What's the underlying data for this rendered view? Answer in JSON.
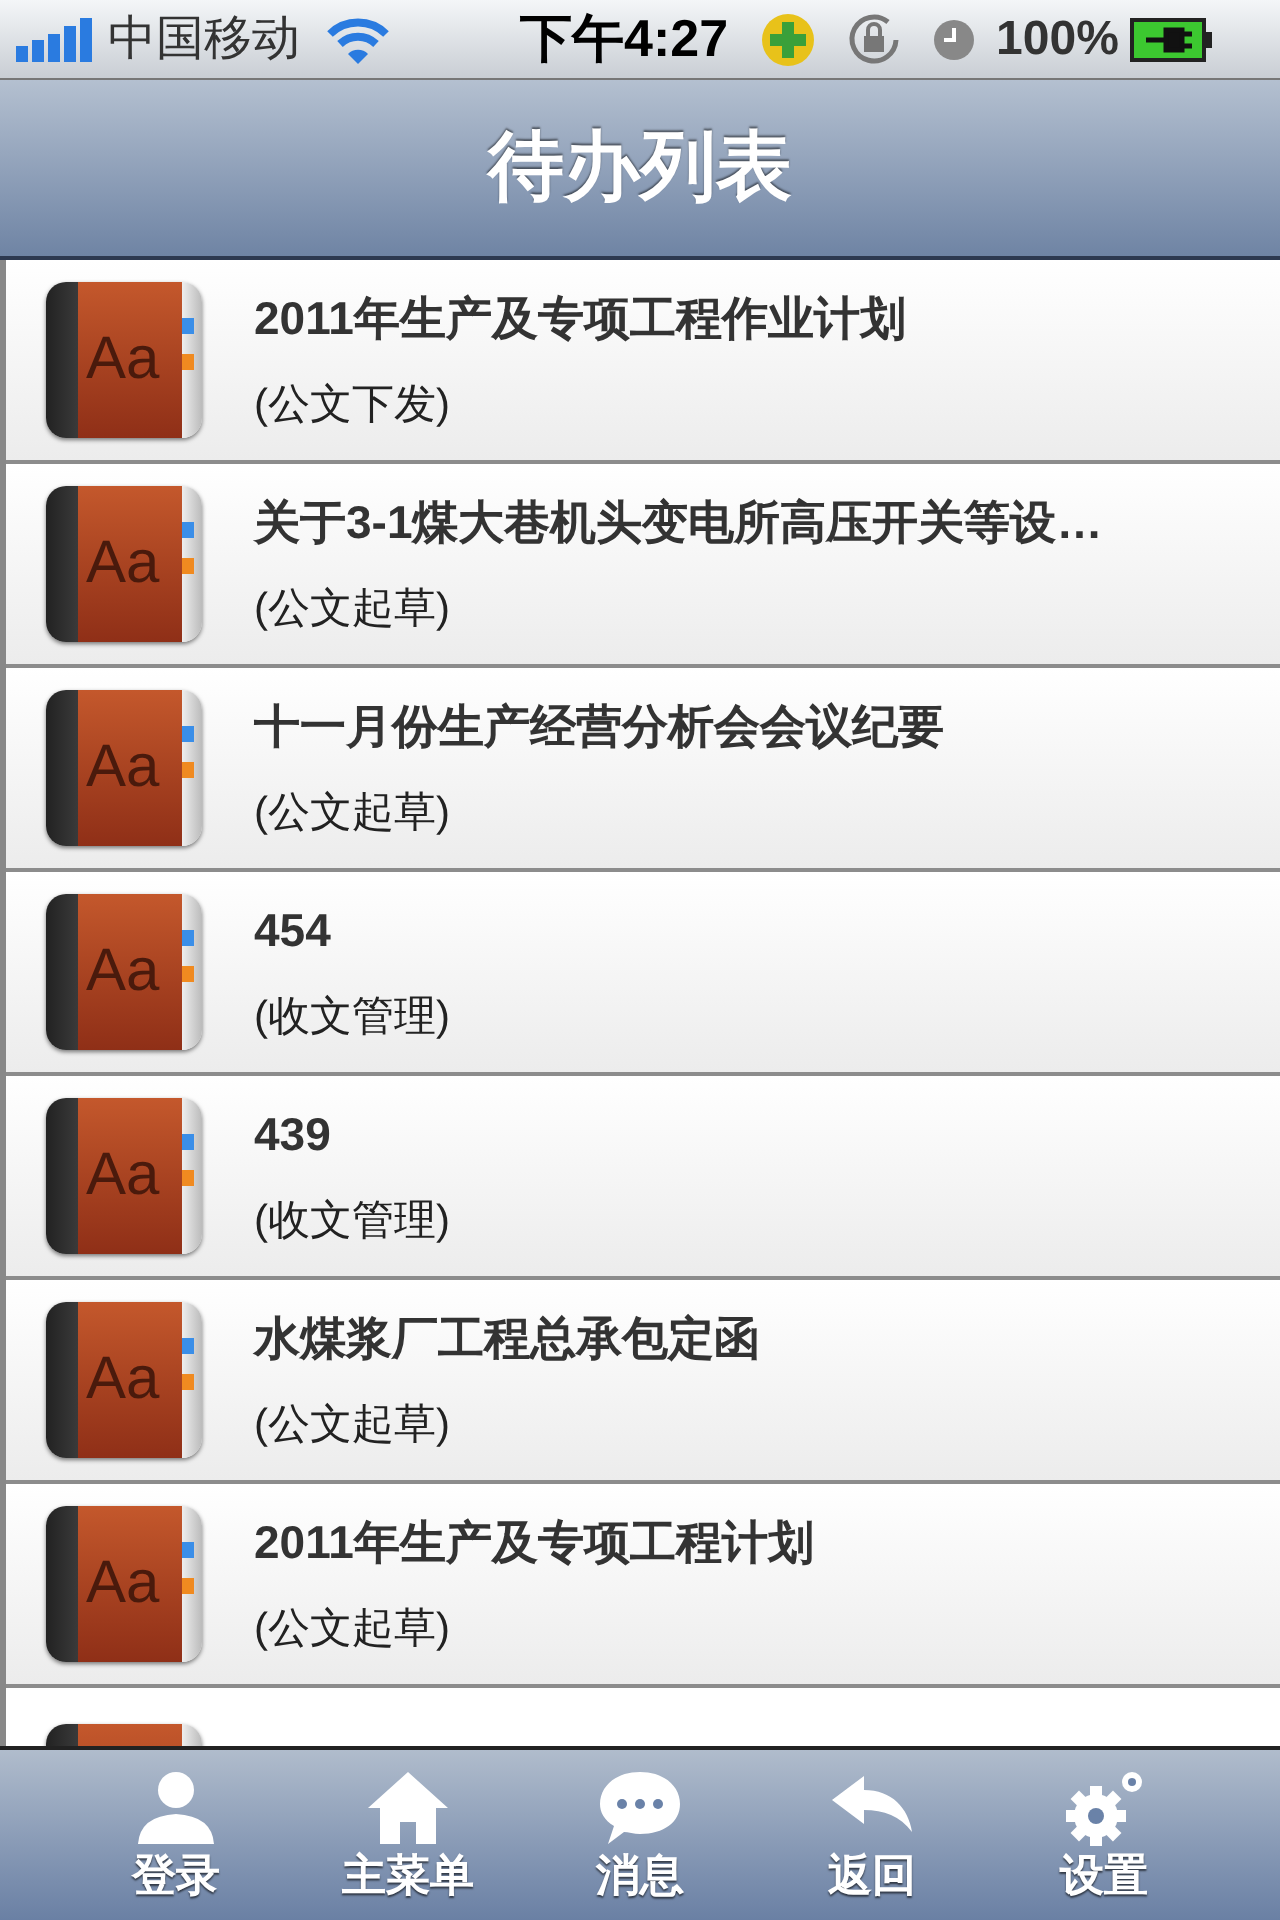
{
  "status_bar": {
    "carrier": "中国移动",
    "time": "下午4:27",
    "battery": "100%"
  },
  "nav_bar": {
    "title": "待办列表"
  },
  "list": [
    {
      "icon_label": "Aa",
      "title": "2011年生产及专项工程作业计划",
      "subtitle": "(公文下发)"
    },
    {
      "icon_label": "Aa",
      "title": "关于3-1煤大巷机头变电所高压开关等设…",
      "subtitle": "(公文起草)"
    },
    {
      "icon_label": "Aa",
      "title": "十一月份生产经营分析会会议纪要",
      "subtitle": "(公文起草)"
    },
    {
      "icon_label": "Aa",
      "title": "454",
      "subtitle": "(收文管理)"
    },
    {
      "icon_label": "Aa",
      "title": "439",
      "subtitle": "(收文管理)"
    },
    {
      "icon_label": "Aa",
      "title": "水煤浆厂工程总承包定函",
      "subtitle": "(公文起草)"
    },
    {
      "icon_label": "Aa",
      "title": "2011年生产及专项工程计划",
      "subtitle": "(公文起草)"
    }
  ],
  "tab_bar": [
    {
      "kind": "person",
      "label": "登录"
    },
    {
      "kind": "home",
      "label": "主菜单"
    },
    {
      "kind": "chat",
      "label": "消息"
    },
    {
      "kind": "back",
      "label": "返回"
    },
    {
      "kind": "gear",
      "label": "设置"
    }
  ]
}
